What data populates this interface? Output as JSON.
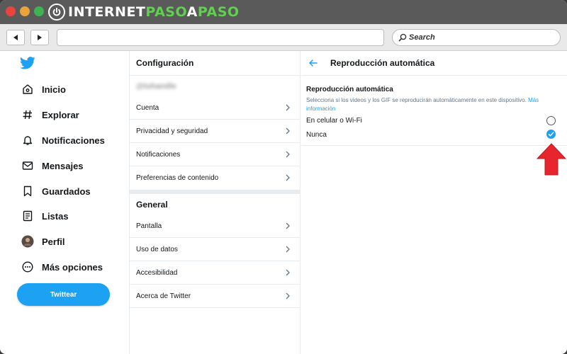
{
  "brand": {
    "logo_text_main": "INTERNET",
    "logo_text_accent": "PASO",
    "logo_text_mid": "A",
    "logo_text_end": "PASO",
    "accent_color": "#5fd14f"
  },
  "browser": {
    "search_placeholder": "Search",
    "url_value": ""
  },
  "twitter": {
    "brand_color": "#1da1f2",
    "nav": [
      {
        "label": "Inicio",
        "icon": "home-icon"
      },
      {
        "label": "Explorar",
        "icon": "hashtag-icon"
      },
      {
        "label": "Notificaciones",
        "icon": "bell-icon"
      },
      {
        "label": "Mensajes",
        "icon": "envelope-icon"
      },
      {
        "label": "Guardados",
        "icon": "bookmark-icon"
      },
      {
        "label": "Listas",
        "icon": "list-icon"
      },
      {
        "label": "Perfil",
        "icon": "avatar-icon"
      },
      {
        "label": "Más opciones",
        "icon": "more-icon"
      }
    ],
    "tweet_button": "Twittear"
  },
  "settings": {
    "title": "Configuración",
    "handle": "@tuhandle",
    "account_items": [
      "Cuenta",
      "Privacidad y seguridad",
      "Notificaciones",
      "Preferencias de contenido"
    ],
    "general_title": "General",
    "general_items": [
      "Pantalla",
      "Uso de datos",
      "Accesibilidad",
      "Acerca de Twitter"
    ]
  },
  "autoplay": {
    "header": "Reproducción automática",
    "section_title": "Reproducción automática",
    "description": "Selecciona si los videos y los GIF se reproducirán automáticamente en este dispositivo.",
    "more_info": "Más información",
    "options": [
      {
        "label": "En celular o Wi-Fi",
        "selected": false
      },
      {
        "label": "Nunca",
        "selected": true
      }
    ]
  }
}
